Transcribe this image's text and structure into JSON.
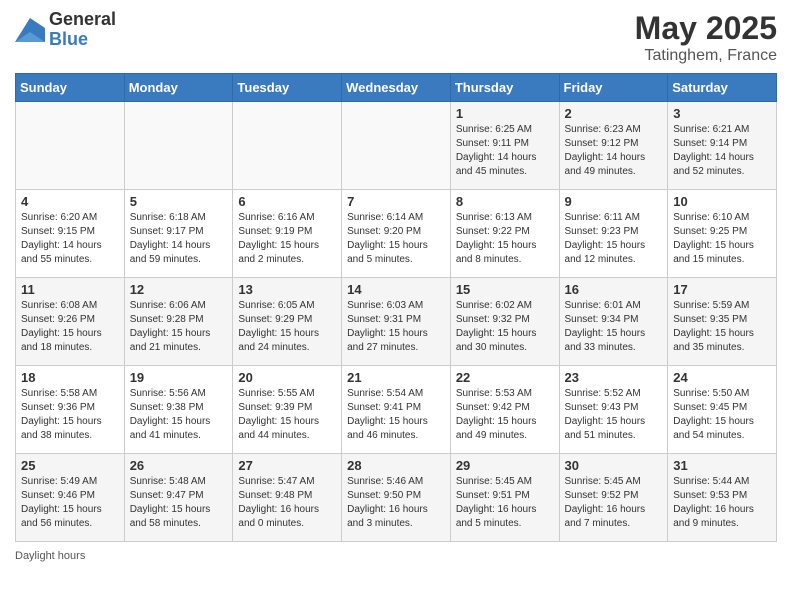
{
  "header": {
    "logo_general": "General",
    "logo_blue": "Blue",
    "month_year": "May 2025",
    "location": "Tatinghem, France"
  },
  "weekdays": [
    "Sunday",
    "Monday",
    "Tuesday",
    "Wednesday",
    "Thursday",
    "Friday",
    "Saturday"
  ],
  "weeks": [
    [
      {
        "day": "",
        "info": ""
      },
      {
        "day": "",
        "info": ""
      },
      {
        "day": "",
        "info": ""
      },
      {
        "day": "",
        "info": ""
      },
      {
        "day": "1",
        "info": "Sunrise: 6:25 AM\nSunset: 9:11 PM\nDaylight: 14 hours\nand 45 minutes."
      },
      {
        "day": "2",
        "info": "Sunrise: 6:23 AM\nSunset: 9:12 PM\nDaylight: 14 hours\nand 49 minutes."
      },
      {
        "day": "3",
        "info": "Sunrise: 6:21 AM\nSunset: 9:14 PM\nDaylight: 14 hours\nand 52 minutes."
      }
    ],
    [
      {
        "day": "4",
        "info": "Sunrise: 6:20 AM\nSunset: 9:15 PM\nDaylight: 14 hours\nand 55 minutes."
      },
      {
        "day": "5",
        "info": "Sunrise: 6:18 AM\nSunset: 9:17 PM\nDaylight: 14 hours\nand 59 minutes."
      },
      {
        "day": "6",
        "info": "Sunrise: 6:16 AM\nSunset: 9:19 PM\nDaylight: 15 hours\nand 2 minutes."
      },
      {
        "day": "7",
        "info": "Sunrise: 6:14 AM\nSunset: 9:20 PM\nDaylight: 15 hours\nand 5 minutes."
      },
      {
        "day": "8",
        "info": "Sunrise: 6:13 AM\nSunset: 9:22 PM\nDaylight: 15 hours\nand 8 minutes."
      },
      {
        "day": "9",
        "info": "Sunrise: 6:11 AM\nSunset: 9:23 PM\nDaylight: 15 hours\nand 12 minutes."
      },
      {
        "day": "10",
        "info": "Sunrise: 6:10 AM\nSunset: 9:25 PM\nDaylight: 15 hours\nand 15 minutes."
      }
    ],
    [
      {
        "day": "11",
        "info": "Sunrise: 6:08 AM\nSunset: 9:26 PM\nDaylight: 15 hours\nand 18 minutes."
      },
      {
        "day": "12",
        "info": "Sunrise: 6:06 AM\nSunset: 9:28 PM\nDaylight: 15 hours\nand 21 minutes."
      },
      {
        "day": "13",
        "info": "Sunrise: 6:05 AM\nSunset: 9:29 PM\nDaylight: 15 hours\nand 24 minutes."
      },
      {
        "day": "14",
        "info": "Sunrise: 6:03 AM\nSunset: 9:31 PM\nDaylight: 15 hours\nand 27 minutes."
      },
      {
        "day": "15",
        "info": "Sunrise: 6:02 AM\nSunset: 9:32 PM\nDaylight: 15 hours\nand 30 minutes."
      },
      {
        "day": "16",
        "info": "Sunrise: 6:01 AM\nSunset: 9:34 PM\nDaylight: 15 hours\nand 33 minutes."
      },
      {
        "day": "17",
        "info": "Sunrise: 5:59 AM\nSunset: 9:35 PM\nDaylight: 15 hours\nand 35 minutes."
      }
    ],
    [
      {
        "day": "18",
        "info": "Sunrise: 5:58 AM\nSunset: 9:36 PM\nDaylight: 15 hours\nand 38 minutes."
      },
      {
        "day": "19",
        "info": "Sunrise: 5:56 AM\nSunset: 9:38 PM\nDaylight: 15 hours\nand 41 minutes."
      },
      {
        "day": "20",
        "info": "Sunrise: 5:55 AM\nSunset: 9:39 PM\nDaylight: 15 hours\nand 44 minutes."
      },
      {
        "day": "21",
        "info": "Sunrise: 5:54 AM\nSunset: 9:41 PM\nDaylight: 15 hours\nand 46 minutes."
      },
      {
        "day": "22",
        "info": "Sunrise: 5:53 AM\nSunset: 9:42 PM\nDaylight: 15 hours\nand 49 minutes."
      },
      {
        "day": "23",
        "info": "Sunrise: 5:52 AM\nSunset: 9:43 PM\nDaylight: 15 hours\nand 51 minutes."
      },
      {
        "day": "24",
        "info": "Sunrise: 5:50 AM\nSunset: 9:45 PM\nDaylight: 15 hours\nand 54 minutes."
      }
    ],
    [
      {
        "day": "25",
        "info": "Sunrise: 5:49 AM\nSunset: 9:46 PM\nDaylight: 15 hours\nand 56 minutes."
      },
      {
        "day": "26",
        "info": "Sunrise: 5:48 AM\nSunset: 9:47 PM\nDaylight: 15 hours\nand 58 minutes."
      },
      {
        "day": "27",
        "info": "Sunrise: 5:47 AM\nSunset: 9:48 PM\nDaylight: 16 hours\nand 0 minutes."
      },
      {
        "day": "28",
        "info": "Sunrise: 5:46 AM\nSunset: 9:50 PM\nDaylight: 16 hours\nand 3 minutes."
      },
      {
        "day": "29",
        "info": "Sunrise: 5:45 AM\nSunset: 9:51 PM\nDaylight: 16 hours\nand 5 minutes."
      },
      {
        "day": "30",
        "info": "Sunrise: 5:45 AM\nSunset: 9:52 PM\nDaylight: 16 hours\nand 7 minutes."
      },
      {
        "day": "31",
        "info": "Sunrise: 5:44 AM\nSunset: 9:53 PM\nDaylight: 16 hours\nand 9 minutes."
      }
    ]
  ],
  "footer": {
    "daylight_label": "Daylight hours"
  }
}
